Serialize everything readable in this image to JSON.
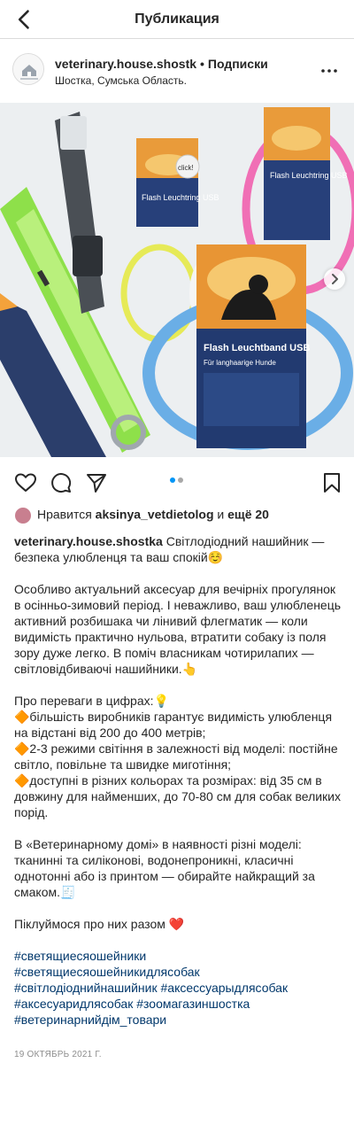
{
  "topbar": {
    "title": "Публикация"
  },
  "post_header": {
    "username": "veterinary.house.shostka",
    "separator": "•",
    "follow_label": "Подписки",
    "location": "Шостка, Сумська Область."
  },
  "carousel": {
    "active_index": 0,
    "count": 2
  },
  "product_labels": {
    "box_main_brand": "Flash Leuchtband USB",
    "box_main_sub": "Für langhaarige Hunde",
    "box_small_brand": "Flash Leuchtring USB",
    "badge": "click!"
  },
  "likes": {
    "prefix": "Нравится",
    "user": "aksinya_vetdietolog",
    "middle": "и",
    "rest": "ещё 20"
  },
  "caption": {
    "user": "veterinary.house.shostka",
    "l1_rest": "Світлодіодний нашийник — безпека улюбленця та ваш спокій☺️",
    "p2": "Особливо актуальний аксесуар для вечірніх прогулянок в осінньо-зимовий період. І неважливо, ваш улюбленець активний розбишака чи лінивий флегматик — коли видимість практично нульова, втратити собаку із поля зору дуже легко. В поміч власникам чотирилапих — світловідбиваючі нашийники.👆",
    "p3_title": "Про переваги в цифрах:💡",
    "p3_b1": "🔶більшість виробників гарантує видимість улюбленця на відстані від 200 до 400 метрів;",
    "p3_b2": "🔶2-3 режими світіння в залежності від моделі: постійне світло, повільне та швидке миготіння;",
    "p3_b3": "🔶доступні в різних кольорах та розмірах: від 35 см в довжину для найменших, до 70-80 см для собак великих порід.",
    "p4": "В «Ветеринарному домі» в наявності різні моделі: тканинні та силіконові, водонепроникні, класичні однотонні або із принтом — обирайте найкращий за смаком.🧾",
    "p5": "Піклуймося про них разом ❤️",
    "tags": [
      "#светящиесяошейники",
      "#светящиесяошейникидлясобак",
      "#світлодіоднийнашийник #аксессуарыдлясобак",
      "#аксесуаридлясобак #зоомагазиншостка",
      "#ветеринарнийдім_товари"
    ]
  },
  "date": "19 ОКТЯБРЬ 2021 Г.",
  "colors": {
    "link": "#00376b",
    "heart": "#ed4956",
    "carousel_active": "#0095f6",
    "carousel_inactive": "#a8a8a8"
  }
}
